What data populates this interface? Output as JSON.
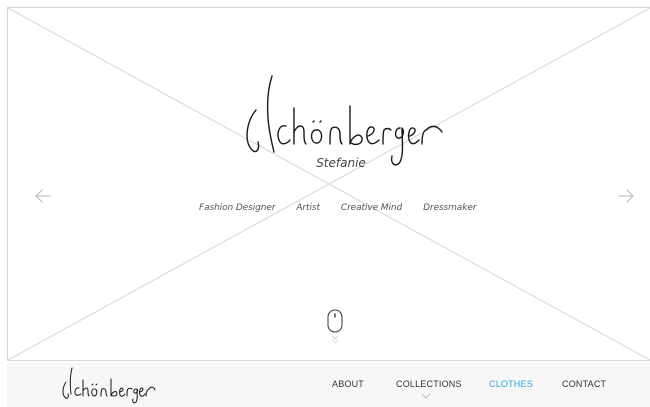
{
  "hero": {
    "logo_text": "Schönberger",
    "first_name": "Stefanie",
    "taglines": [
      "Fashion Designer",
      "Artist",
      "Creative Mind",
      "Dressmaker"
    ],
    "prev_icon": "arrow-left-icon",
    "next_icon": "arrow-right-icon",
    "scroll_icon": "mouse-scroll-icon"
  },
  "nav": {
    "logo_text": "Schönberger",
    "items": [
      {
        "label": "ABOUT",
        "active": false
      },
      {
        "label": "COLLECTIONS",
        "active": false,
        "has_dropdown": true
      },
      {
        "label": "CLOTHES",
        "active": true
      },
      {
        "label": "CONTACT",
        "active": false
      }
    ]
  },
  "colors": {
    "accent": "#29a7e1",
    "text": "#333333",
    "navbar_bg": "#f7f7f7",
    "placeholder_lines": "#d6d6d6"
  }
}
